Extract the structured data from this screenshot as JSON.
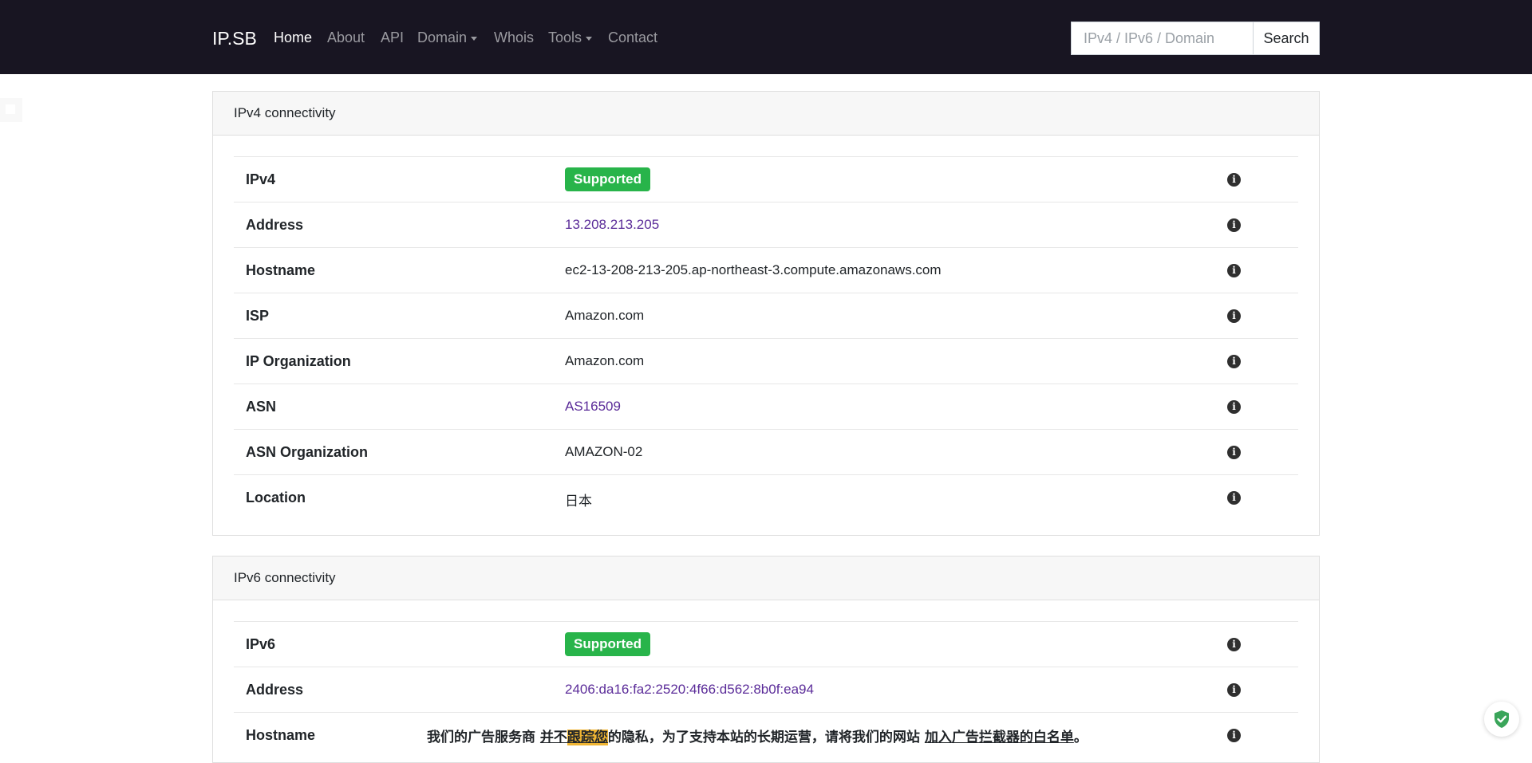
{
  "navbar": {
    "brand": "IP.SB",
    "items": [
      {
        "label": "Home"
      },
      {
        "label": "About"
      },
      {
        "label": "API"
      },
      {
        "label": "Domain"
      },
      {
        "label": "Whois"
      },
      {
        "label": "Tools"
      },
      {
        "label": "Contact"
      }
    ],
    "search": {
      "placeholder": "IPv4 / IPv6 / Domain",
      "value": "",
      "button_label": "Search"
    }
  },
  "ipv4": {
    "title": "IPv4 connectivity",
    "rows": [
      {
        "label": "IPv4",
        "value": "Supported"
      },
      {
        "label": "Address",
        "value": "13.208.213.205"
      },
      {
        "label": "Hostname",
        "value": "ec2-13-208-213-205.ap-northeast-3.compute.amazonaws.com"
      },
      {
        "label": "ISP",
        "value": "Amazon.com"
      },
      {
        "label": "IP Organization",
        "value": "Amazon.com"
      },
      {
        "label": "ASN",
        "value": "AS16509"
      },
      {
        "label": "ASN Organization",
        "value": "AMAZON-02"
      },
      {
        "label": "Location",
        "value": "日本"
      }
    ]
  },
  "ipv6": {
    "title": "IPv6 connectivity",
    "rows": [
      {
        "label": "IPv6",
        "value": "Supported"
      },
      {
        "label": "Address",
        "value": "2406:da16:fa2:2520:4f66:d562:8b0f:ea94"
      },
      {
        "label": "Hostname",
        "value": ""
      }
    ]
  },
  "ad_notice": {
    "part1": "我们的广告服务商",
    "part2": "并不",
    "part3": "跟踪您",
    "part4": "的隐私，为了支持本站的长期运营，请将我们的网站",
    "part5": "加入广告拦截器的白名单",
    "part6": "。"
  },
  "colors": {
    "navbar_bg": "#181522",
    "badge_green": "#28b44a",
    "link_purple": "#5b2c99",
    "highlight": "#f0b533",
    "shield_green": "#3aa55a"
  },
  "icons": {
    "info": "info-circle-icon",
    "shield": "shield-check-icon"
  }
}
